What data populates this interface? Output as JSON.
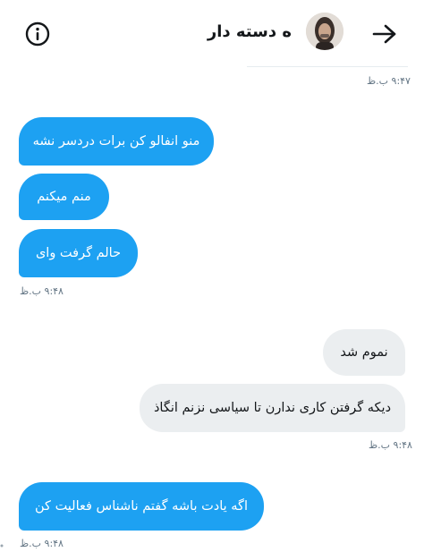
{
  "header": {
    "title": "ه دسته دار",
    "icons": {
      "info": "info-icon",
      "back": "arrow-right-icon",
      "avatar": "avatar"
    }
  },
  "colors": {
    "incoming_bubble": "#1da1f2",
    "outgoing_bubble": "#ebeef0",
    "timestamp": "#657786"
  },
  "messages": {
    "top_timestamp": "۹:۴۷ ب.ظ",
    "group1": {
      "m1": "منو انفالو کن برات دردسر نشه",
      "m2": "منم میکنم",
      "m3": "حالم گرفت وای",
      "timestamp": "۹:۴۸ ب.ظ"
    },
    "group2": {
      "m1": "نموم شد",
      "m2": "دیکه گرفتن کاری ندارن تا سیاسی نزنم انگاذ",
      "timestamp": "۹:۴۸ ب.ظ"
    },
    "group3": {
      "m1": "اگه یادت باشه گفتم ناشناس فعالیت کن",
      "timestamp": "۹:۴۸ ب.ظ"
    }
  }
}
